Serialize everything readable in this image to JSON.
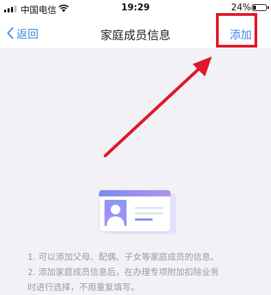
{
  "status_bar": {
    "carrier": "中国电信",
    "time": "19:29",
    "battery": "24%",
    "battery_level": 0.24
  },
  "nav": {
    "back_label": "返回",
    "title": "家庭成员信息",
    "add_label": "添加"
  },
  "tips": [
    "1. 可以添加父母、配偶、子女等家庭成员的信息。",
    "2. 添加家庭成员信息后，在办理专项附加扣除业务",
    "时进行选择，不用重复填写。"
  ],
  "colors": {
    "accent": "#3a86e8",
    "annotation": "#e0182a",
    "background": "#f2f2f6"
  }
}
